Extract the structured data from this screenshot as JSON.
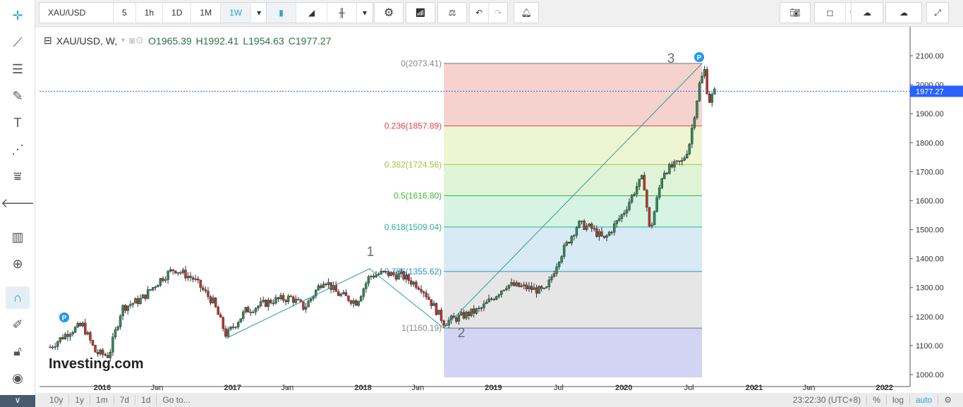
{
  "toolbar": {
    "symbol": "XAU/USD",
    "intervals": [
      "5",
      "1h",
      "1D",
      "1M",
      "1W"
    ],
    "active_interval": "1W"
  },
  "legend": {
    "title": "XAU/USD, W,",
    "open": "O1965.39",
    "high": "H1992.41",
    "low": "L1954.63",
    "close": "C1977.27"
  },
  "price_axis": {
    "ticks": [
      "2100.00",
      "2000.00",
      "1900.00",
      "1800.00",
      "1700.00",
      "1600.00",
      "1500.00",
      "1400.00",
      "1300.00",
      "1200.00",
      "1100.00",
      "1000.00"
    ],
    "current": "1977.27"
  },
  "time_axis": {
    "ticks": [
      [
        "2016",
        2016
      ],
      [
        "Jun",
        2016.42
      ],
      [
        "2017",
        2017
      ],
      [
        "Jun",
        2017.42
      ],
      [
        "2018",
        2018
      ],
      [
        "Jun",
        2018.42
      ],
      [
        "2019",
        2019
      ],
      [
        "Jul",
        2019.5
      ],
      [
        "2020",
        2020
      ],
      [
        "Jul",
        2020.5
      ],
      [
        "2021",
        2021
      ],
      [
        "Jun",
        2021.42
      ],
      [
        "2022",
        2022
      ]
    ]
  },
  "fib": {
    "levels": [
      {
        "label": "0(2073.41)",
        "price": 2073.41,
        "color": "#888888"
      },
      {
        "label": "0.236(1857.89)",
        "price": 1857.89,
        "color": "#e04848"
      },
      {
        "label": "0.382(1724.56)",
        "price": 1724.56,
        "color": "#9bc53d"
      },
      {
        "label": "0.5(1616.80)",
        "price": 1616.8,
        "color": "#3cb93c"
      },
      {
        "label": "0.618(1509.04)",
        "price": 1509.04,
        "color": "#2bb38f"
      },
      {
        "label": "0.786(1355.62)",
        "price": 1355.62,
        "color": "#2a8fd0"
      },
      {
        "label": "1(1160.19)",
        "price": 1160.19,
        "color": "#888888"
      }
    ]
  },
  "waves": {
    "labels": [
      "1",
      "2",
      "3"
    ]
  },
  "price_path": [
    [
      2015.6,
      1095
    ],
    [
      2015.75,
      1150
    ],
    [
      2015.85,
      1170
    ],
    [
      2015.95,
      1075
    ],
    [
      2016.05,
      1065
    ],
    [
      2016.15,
      1230
    ],
    [
      2016.3,
      1260
    ],
    [
      2016.45,
      1330
    ],
    [
      2016.55,
      1365
    ],
    [
      2016.7,
      1330
    ],
    [
      2016.85,
      1250
    ],
    [
      2016.95,
      1135
    ],
    [
      2017.1,
      1220
    ],
    [
      2017.3,
      1255
    ],
    [
      2017.45,
      1265
    ],
    [
      2017.55,
      1230
    ],
    [
      2017.7,
      1330
    ],
    [
      2017.8,
      1280
    ],
    [
      2017.95,
      1250
    ],
    [
      2018.05,
      1340
    ],
    [
      2018.15,
      1350
    ],
    [
      2018.3,
      1340
    ],
    [
      2018.45,
      1300
    ],
    [
      2018.62,
      1180
    ],
    [
      2018.75,
      1200
    ],
    [
      2018.9,
      1225
    ],
    [
      2019.1,
      1310
    ],
    [
      2019.25,
      1300
    ],
    [
      2019.4,
      1285
    ],
    [
      2019.5,
      1400
    ],
    [
      2019.65,
      1520
    ],
    [
      2019.75,
      1505
    ],
    [
      2019.85,
      1465
    ],
    [
      2020.0,
      1560
    ],
    [
      2020.1,
      1650
    ],
    [
      2020.15,
      1680
    ],
    [
      2020.2,
      1490
    ],
    [
      2020.3,
      1700
    ],
    [
      2020.45,
      1735
    ],
    [
      2020.5,
      1790
    ],
    [
      2020.58,
      2000
    ],
    [
      2020.62,
      2050
    ],
    [
      2020.65,
      1940
    ],
    [
      2020.7,
      1977
    ]
  ],
  "watermark": "Investing.com",
  "bottom": {
    "ranges": [
      "10y",
      "1y",
      "1m",
      "7d",
      "1d",
      "Go to..."
    ],
    "time": "23:22:30 (UTC+8)",
    "pct": "%",
    "log": "log",
    "auto": "auto"
  }
}
